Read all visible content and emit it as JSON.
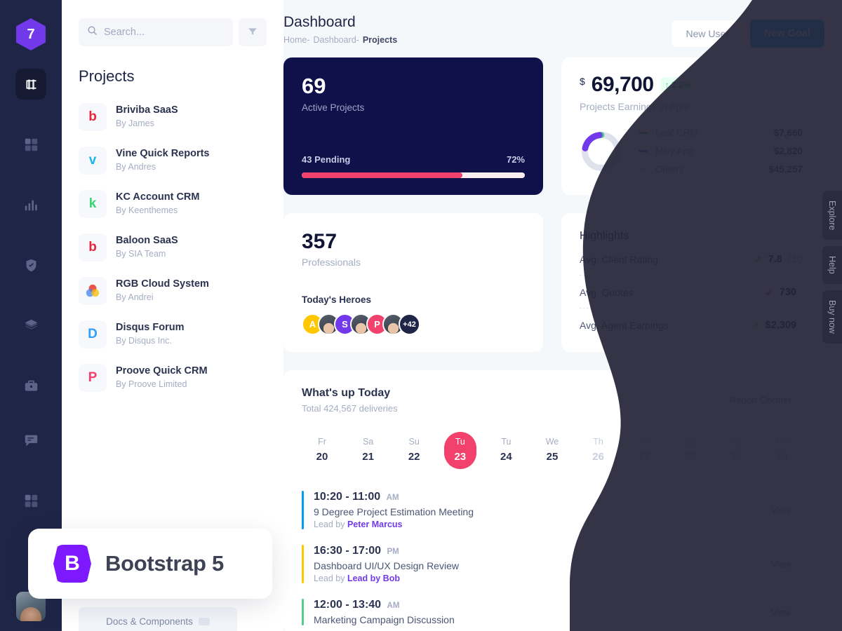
{
  "rail": {
    "logo_label": "7",
    "icons": [
      {
        "name": "cube-icon",
        "active": true
      },
      {
        "name": "grid-icon",
        "active": false
      },
      {
        "name": "bar-chart-icon",
        "active": false
      },
      {
        "name": "shield-check-icon",
        "active": false
      },
      {
        "name": "layers-icon",
        "active": false
      },
      {
        "name": "briefcase-icon",
        "active": false
      }
    ],
    "bottom_icons": [
      {
        "name": "chat-icon"
      },
      {
        "name": "grid-icon"
      }
    ]
  },
  "panel": {
    "search": {
      "value": "",
      "placeholder": "Search..."
    },
    "filter_icon": "filter-icon",
    "title": "Projects",
    "projects": [
      {
        "name": "Briviba SaaS",
        "by": "By James",
        "mark": "b",
        "color": "#e8253b"
      },
      {
        "name": "Vine Quick Reports",
        "by": "By Andres",
        "mark": "v",
        "color": "#1ab7ea"
      },
      {
        "name": "KC Account CRM",
        "by": "By Keenthemes",
        "mark": "k",
        "color": "#36d576"
      },
      {
        "name": "Baloon SaaS",
        "by": "By SIA Team",
        "mark": "b",
        "color": "#e8253b"
      },
      {
        "name": "RGB Cloud System",
        "by": "By Andrei",
        "mark": "o",
        "color": "#f0b400"
      },
      {
        "name": "Disqus Forum",
        "by": "By Disqus Inc.",
        "mark": "D",
        "color": "#2e9fff"
      },
      {
        "name": "Proove Quick CRM",
        "by": "By Proove Limited",
        "mark": "P",
        "color": "#f1416c"
      }
    ],
    "docs_label": "Docs & Components",
    "collapse_icon": "chevron-left-icon"
  },
  "header": {
    "title": "Dashboard",
    "breadcrumbs": [
      "Home-",
      "Dashboard-",
      "Projects"
    ],
    "new_user_label": "New User",
    "new_goal_label": "New Goal"
  },
  "active_projects": {
    "value": "69",
    "label": "Active Projects",
    "pending": "43 Pending",
    "percent_label": "72%",
    "percent": 72,
    "bar_color": "#f1416c"
  },
  "earnings": {
    "currency": "$",
    "value": "69,700",
    "delta": "2.2%",
    "delta_arrow": "↑",
    "subtitle": "Projects Earnings in April",
    "legend": [
      {
        "label": "Leaf CRM",
        "amount": "$7,660",
        "color": "#50cd89"
      },
      {
        "label": "Mivy App",
        "amount": "$2,820",
        "color": "#7239ea"
      },
      {
        "label": "Others",
        "amount": "$45,257",
        "color": "#dfe2ec"
      }
    ]
  },
  "chart_data": {
    "type": "pie",
    "title": "Projects Earnings in April",
    "labels": [
      "Leaf CRM",
      "Mivy App",
      "Others"
    ],
    "values": [
      7660,
      2820,
      45257
    ],
    "display_values": [
      "$7,660",
      "$2,820",
      "$45,257"
    ],
    "colors": [
      "#50cd89",
      "#7239ea",
      "#dfe2ec"
    ],
    "arc_fractions": [
      0.45,
      0.2,
      0.35
    ],
    "total": "69,700",
    "legend": "right",
    "donut": true
  },
  "professionals": {
    "value": "357",
    "label": "Professionals",
    "heroes_title": "Today's Heroes",
    "avatars": [
      {
        "type": "initial",
        "text": "A",
        "color": "#ffc700"
      },
      {
        "type": "photo",
        "text": ""
      },
      {
        "type": "initial",
        "text": "S",
        "color": "#7239ea"
      },
      {
        "type": "photo",
        "text": ""
      },
      {
        "type": "initial",
        "text": "P",
        "color": "#f1416c"
      },
      {
        "type": "photo",
        "text": ""
      },
      {
        "type": "more",
        "text": "+42"
      }
    ]
  },
  "highlights": {
    "title": "Highlights",
    "rows": [
      {
        "label": "Avg. Client Rating",
        "arrow": "↗",
        "dir": "up",
        "value": "7.8",
        "suffix": "/10"
      },
      {
        "label": "Avg. Quotes",
        "arrow": "↙",
        "dir": "down",
        "value": "730",
        "suffix": ""
      },
      {
        "label": "Avg. Agent Earnings",
        "arrow": "↗",
        "dir": "up",
        "value": "$2,309",
        "suffix": ""
      }
    ]
  },
  "whats_up": {
    "title": "What's up Today",
    "subtitle": "Total 424,567 deliveries",
    "report_label": "Report Cecnter",
    "days": [
      {
        "dow": "Fr",
        "num": "20",
        "state": "normal"
      },
      {
        "dow": "Sa",
        "num": "21",
        "state": "normal"
      },
      {
        "dow": "Su",
        "num": "22",
        "state": "normal"
      },
      {
        "dow": "Tu",
        "num": "23",
        "state": "selected"
      },
      {
        "dow": "Tu",
        "num": "24",
        "state": "normal"
      },
      {
        "dow": "We",
        "num": "25",
        "state": "normal"
      },
      {
        "dow": "Th",
        "num": "26",
        "state": "dim"
      },
      {
        "dow": "Fri",
        "num": "27",
        "state": "dim"
      },
      {
        "dow": "Sa",
        "num": "28",
        "state": "dim"
      },
      {
        "dow": "Su",
        "num": "29",
        "state": "dim"
      },
      {
        "dow": "Mo",
        "num": "30",
        "state": "dim"
      }
    ],
    "events": [
      {
        "time": "10:20 - 11:00",
        "ampm": "AM",
        "name": "9 Degree Project Estimation Meeting",
        "lead_prefix": "Lead by ",
        "lead": "Peter Marcus",
        "color": "#009ef7",
        "view_label": "View"
      },
      {
        "time": "16:30 - 17:00",
        "ampm": "PM",
        "name": "Dashboard UI/UX Design Review",
        "lead_prefix": "Lead by ",
        "lead": "Lead by Bob",
        "color": "#ffc700",
        "view_label": "View"
      },
      {
        "time": "12:00 - 13:40",
        "ampm": "AM",
        "name": "Marketing Campaign Discussion",
        "lead_prefix": "Lead by ",
        "lead": "",
        "color": "#50cd89",
        "view_label": "View"
      }
    ]
  },
  "vtabs": [
    "Explore",
    "Help",
    "Buy now"
  ],
  "bootstrap_badge": {
    "logo_letter": "B",
    "text": "Bootstrap 5",
    "color": "#7e19ff"
  },
  "theme": {
    "accent": "#009ef7",
    "danger": "#f1416c",
    "success": "#50cd89",
    "purple": "#7239ea",
    "rail_bg": "#1e2546",
    "dark_overlay": "#252538",
    "dark_card": "#10104a"
  }
}
